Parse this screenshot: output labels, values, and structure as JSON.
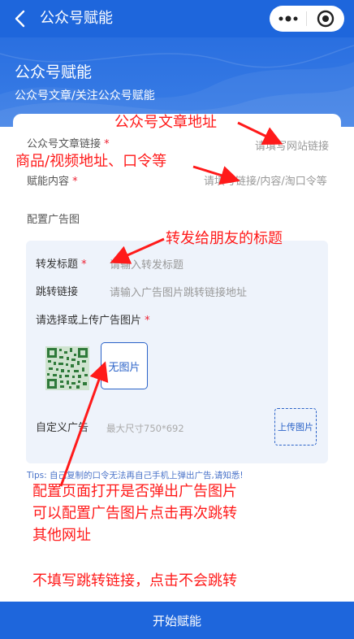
{
  "nav": {
    "title": "公众号赋能",
    "back_icon": "chevron-left-icon",
    "more_icon": "more-dots-icon",
    "close_icon": "target-circle-icon"
  },
  "hero": {
    "title": "公众号赋能",
    "subtitle": "公众号文章/关注公众号赋能"
  },
  "form": {
    "article_link": {
      "label": "公众号文章链接",
      "placeholder": "请填写网站链接"
    },
    "content": {
      "label": "赋能内容",
      "placeholder": "请填写链接/内容/淘口令等"
    },
    "ad_section_label": "配置广告图",
    "share_title": {
      "label": "转发标题",
      "placeholder": "请输入转发标题"
    },
    "jump_link": {
      "label": "跳转链接",
      "placeholder": "请输入广告图片跳转链接地址"
    },
    "select_upload_label": "请选择或上传广告图片",
    "no_image_button": "无图片",
    "custom_ad": {
      "label": "自定义广告",
      "hint": "最大尺寸750*692",
      "upload_button": "上传图片"
    },
    "tips": "Tips: 自己复制的口令无法再自己手机上弹出广告,请知悉!"
  },
  "annotations": {
    "a1": "公众号文章地址",
    "a2": "商品/视频地址、口令等",
    "a3": "转发给朋友的标题",
    "a4_line1": "配置页面打开是否弹出广告图片",
    "a4_line2": "可以配置广告图片点击再次跳转",
    "a4_line3": "其他网址",
    "a5": "不填写跳转链接，点击不会跳转"
  },
  "bottom_button": "开始赋能",
  "colors": {
    "primary": "#1e66dc",
    "annotation": "#ff1a1a",
    "required": "#e22233",
    "tips": "#4b74c9"
  }
}
